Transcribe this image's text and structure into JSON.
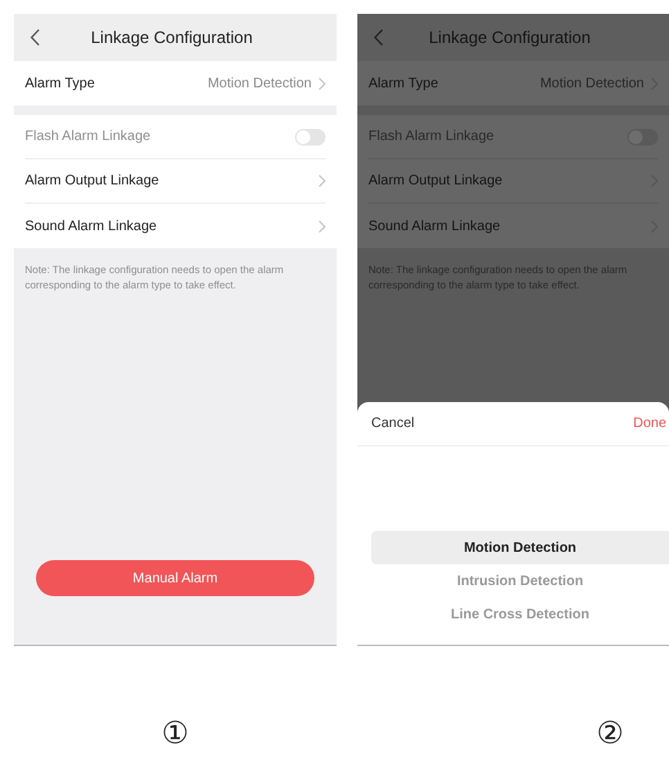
{
  "screens": [
    {
      "label": "①",
      "title": "Linkage Configuration",
      "alarm_type": {
        "label": "Alarm Type",
        "value": "Motion Detection"
      },
      "rows": [
        {
          "kind": "toggle",
          "label": "Flash Alarm Linkage",
          "disabled": true,
          "on": false
        },
        {
          "kind": "link",
          "label": "Alarm Output Linkage",
          "disabled": false
        },
        {
          "kind": "link",
          "label": "Sound Alarm Linkage",
          "disabled": false
        }
      ],
      "note": "Note: The linkage configuration needs to open the alarm corresponding to the alarm type to take effect.",
      "button": "Manual Alarm"
    },
    {
      "label": "②",
      "title": "Linkage Configuration",
      "alarm_type": {
        "label": "Alarm Type",
        "value": "Motion Detection"
      },
      "rows": [
        {
          "kind": "toggle",
          "label": "Flash Alarm Linkage",
          "disabled": true,
          "on": false
        },
        {
          "kind": "link",
          "label": "Alarm Output Linkage",
          "disabled": false
        },
        {
          "kind": "link",
          "label": "Sound Alarm Linkage",
          "disabled": false
        }
      ],
      "note": "Note: The linkage configuration needs to open the alarm corresponding to the alarm type to take effect.",
      "picker": {
        "cancel": "Cancel",
        "done": "Done",
        "options": [
          {
            "label": "Motion Detection",
            "selected": true
          },
          {
            "label": "Intrusion Detection",
            "selected": false
          },
          {
            "label": "Line Cross Detection",
            "selected": false
          }
        ]
      }
    }
  ]
}
